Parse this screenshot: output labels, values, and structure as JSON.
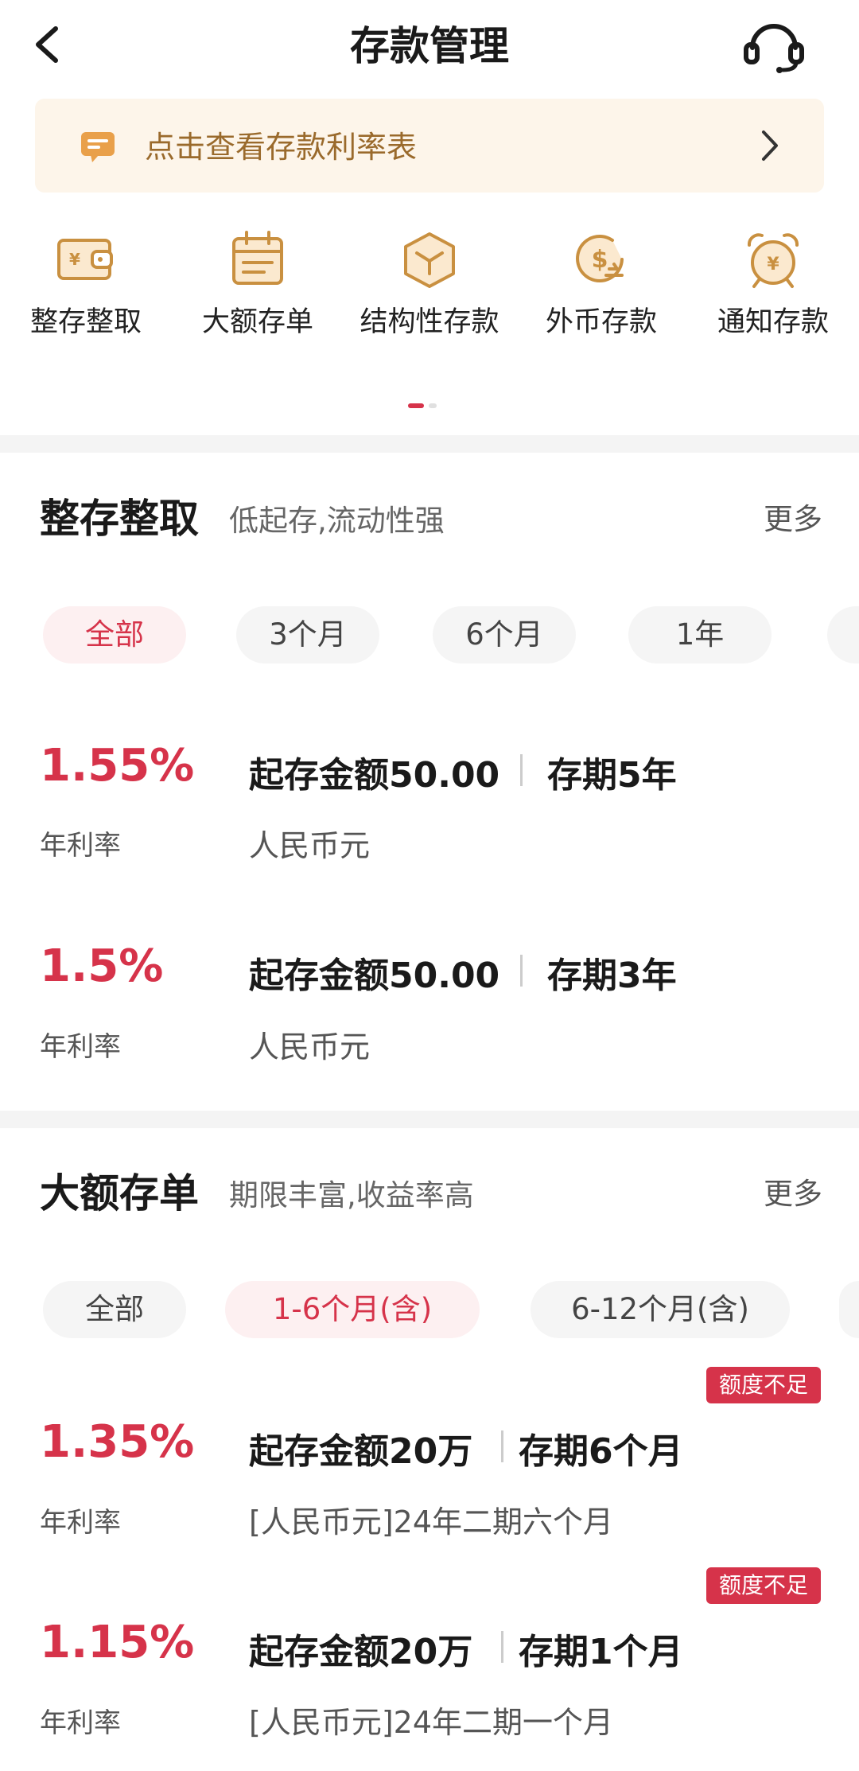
{
  "header": {
    "title": "存款管理"
  },
  "banner": {
    "text": "点击查看存款利率表"
  },
  "categories": [
    {
      "label": "整存整取",
      "icon": "wallet-yen-icon"
    },
    {
      "label": "大额存单",
      "icon": "calendar-icon"
    },
    {
      "label": "结构性存款",
      "icon": "cube-icon"
    },
    {
      "label": "外币存款",
      "icon": "dollar-exchange-icon"
    },
    {
      "label": "通知存款",
      "icon": "alarm-clock-yen-icon"
    }
  ],
  "pager": {
    "page": 1,
    "total": 2
  },
  "sections": [
    {
      "title": "整存整取",
      "subtitle": "低起存,流动性强",
      "more": "更多",
      "filters": [
        "全部",
        "3个月",
        "6个月",
        "1年"
      ],
      "selected_filter": "全部",
      "products": [
        {
          "rate": "1.55%",
          "rate_label": "年利率",
          "amount": "起存金额50.00",
          "term": "存期5年",
          "desc": "人民币元"
        },
        {
          "rate": "1.5%",
          "rate_label": "年利率",
          "amount": "起存金额50.00",
          "term": "存期3年",
          "desc": "人民币元"
        }
      ]
    },
    {
      "title": "大额存单",
      "subtitle": "期限丰富,收益率高",
      "more": "更多",
      "filters": [
        "全部",
        "1-6个月(含)",
        "6-12个月(含)"
      ],
      "selected_filter": "1-6个月(含)",
      "products": [
        {
          "rate": "1.35%",
          "rate_label": "年利率",
          "amount": "起存金额20万",
          "term": "存期6个月",
          "desc": "[人民币元]24年二期六个月",
          "badge": "额度不足"
        },
        {
          "rate": "1.15%",
          "rate_label": "年利率",
          "amount": "起存金额20万",
          "term": "存期1个月",
          "desc": "[人民币元]24年二期一个月",
          "badge": "额度不足"
        }
      ]
    }
  ],
  "colors": {
    "accent": "#d6334a",
    "gold": "#c99040",
    "banner_bg": "#fdf5ea",
    "banner_text": "#9a6a2c"
  }
}
